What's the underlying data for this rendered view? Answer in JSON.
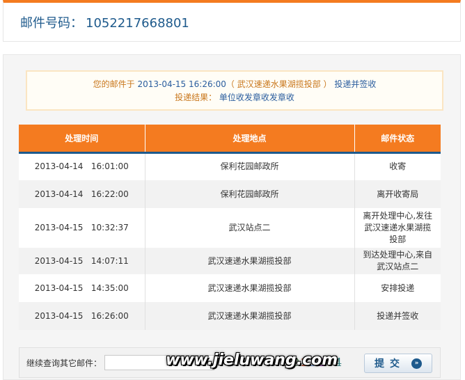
{
  "header": {
    "label": "邮件号码：",
    "tracking_number": "1052217668801"
  },
  "notice": {
    "line1_prefix": "您的邮件于",
    "datetime": "2013-04-15 16:26:00",
    "location": "（ 武汉速递水果湖揽投部 ）",
    "action": "投递并签收",
    "result_label": "投递结果：",
    "result_value": "单位收发章收发章收"
  },
  "table": {
    "headers": [
      "处理时间",
      "处理地点",
      "邮件状态"
    ],
    "rows": [
      {
        "date": "2013-04-14",
        "time": "16:01:00",
        "place": "保利花园邮政所",
        "status": "收寄"
      },
      {
        "date": "2013-04-14",
        "time": "16:22:00",
        "place": "保利花园邮政所",
        "status": "离开收寄局"
      },
      {
        "date": "2013-04-15",
        "time": "10:32:37",
        "place": "武汉站点二",
        "status": "离开处理中心,发往武汉速递水果湖揽投部"
      },
      {
        "date": "2013-04-15",
        "time": "14:07:11",
        "place": "武汉速递水果湖揽投部",
        "status": "到达处理中心,来自武汉站点二"
      },
      {
        "date": "2013-04-15",
        "time": "14:35:00",
        "place": "武汉速递水果湖揽投部",
        "status": "安排投递"
      },
      {
        "date": "2013-04-15",
        "time": "16:26:00",
        "place": "武汉速递水果湖揽投部",
        "status": "投递并签收"
      }
    ]
  },
  "query": {
    "label": "继续查询其它邮件：",
    "input_value": "",
    "captcha": [
      "9",
      "2",
      "3",
      "2",
      "8",
      "4"
    ],
    "submit_label": "提交",
    "submit_icon": "»"
  },
  "watermark": "www.jieluwang.com",
  "colors": {
    "accent": "#f47b20",
    "brand_blue": "#1e5a8c"
  }
}
